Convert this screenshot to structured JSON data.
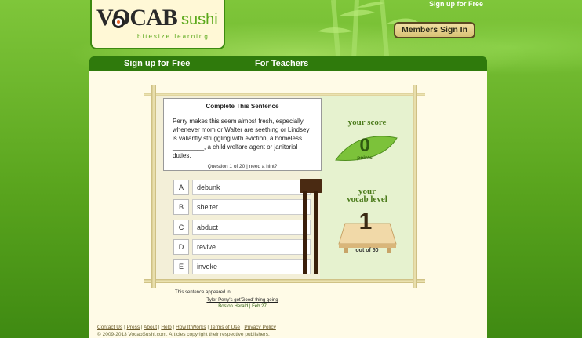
{
  "header": {
    "logo_main": "VOCAB",
    "logo_sushi": "sushi",
    "tagline": "bitesize learning",
    "top_signup": "Sign up for Free",
    "members_signin": "Members Sign In"
  },
  "nav": {
    "signup": "Sign up for Free",
    "teachers": "For Teachers"
  },
  "question": {
    "title": "Complete This Sentence",
    "text": "Perry makes this seem almost fresh, especially whenever mom or Walter are seething or Lindsey is valiantly struggling with eviction, a homeless _________, a child welfare agent or janitorial duties.",
    "progress": "Question 1 of 20",
    "separator": "|",
    "hint": "need a hint?"
  },
  "answers": [
    {
      "letter": "A",
      "word": "debunk"
    },
    {
      "letter": "B",
      "word": "shelter"
    },
    {
      "letter": "C",
      "word": "abduct"
    },
    {
      "letter": "D",
      "word": "revive"
    },
    {
      "letter": "E",
      "word": "invoke"
    }
  ],
  "score": {
    "title": "your score",
    "value": "0",
    "unit": "points"
  },
  "level": {
    "title_line1": "your",
    "title_line2": "vocab level",
    "value": "1",
    "out_of": "out of 50"
  },
  "source": {
    "appeared": "This sentence appeared in:",
    "article": "Tyler Perry's got'Good' thing going",
    "publication": "Boston Herald | Feb 27"
  },
  "footer": {
    "links": [
      "Contact Us",
      "Press",
      "About",
      "Help",
      "How It Works",
      "Terms of Use",
      "Privacy Policy"
    ],
    "copyright": "© 2009-2013 VocabSushi.com. Articles copyright their respective publishers."
  },
  "colors": {
    "background_green": "#5aa51e",
    "nav_green": "#2f7a0c",
    "panel_cream": "#fffbe7",
    "bamboo": "#c8b97a"
  }
}
